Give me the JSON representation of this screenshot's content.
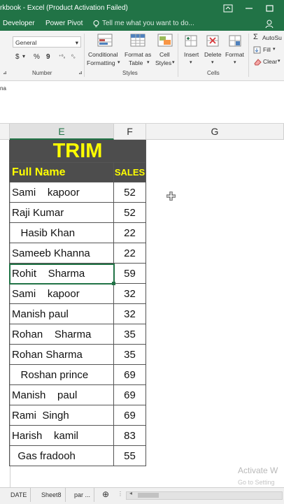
{
  "window": {
    "title": "rkbook - Excel (Product Activation Failed)"
  },
  "ribbon_tabs": {
    "developer": "Developer",
    "power_pivot": "Power Pivot",
    "tell_me": "Tell me what you want to do..."
  },
  "ribbon": {
    "number_format": "General",
    "currency_symbol": "$",
    "percent_symbol": "%",
    "comma_symbol": "9",
    "conditional_formatting": [
      "Conditional",
      "Formatting"
    ],
    "format_as_table": [
      "Format as",
      "Table"
    ],
    "cell_styles": [
      "Cell",
      "Styles"
    ],
    "insert": "Insert",
    "delete": "Delete",
    "format": "Format",
    "autosum": "AutoSu",
    "fill": "Fill",
    "clear": "Clear",
    "groups": {
      "number": "Number",
      "styles": "Styles",
      "cells": "Cells"
    }
  },
  "formula_bar": {
    "name_box_fragment": "na"
  },
  "columns": [
    "E",
    "F",
    "G"
  ],
  "table": {
    "title": "TRIM",
    "header_name": "Full Name",
    "header_sales": "SALES",
    "rows": [
      {
        "name": "Sami    kapoor",
        "sales": "52"
      },
      {
        "name": "Raji Kumar",
        "sales": "52"
      },
      {
        "name": "   Hasib Khan",
        "sales": "22"
      },
      {
        "name": "Sameeb Khanna",
        "sales": "22"
      },
      {
        "name": "Rohit    Sharma",
        "sales": "59"
      },
      {
        "name": "Sami    kapoor",
        "sales": "32"
      },
      {
        "name": "Manish paul",
        "sales": "32"
      },
      {
        "name": "Rohan    Sharma",
        "sales": "35"
      },
      {
        "name": "Rohan Sharma",
        "sales": "35"
      },
      {
        "name": "   Roshan prince",
        "sales": "69"
      },
      {
        "name": "Manish    paul",
        "sales": "69"
      },
      {
        "name": "Rami  Singh",
        "sales": "69"
      },
      {
        "name": "Harish    kamil",
        "sales": "83"
      },
      {
        "name": "  Gas fradooh",
        "sales": "55"
      }
    ]
  },
  "sheet_tabs": [
    "DATE",
    "Sheet8",
    "par ..."
  ],
  "watermark": {
    "line1": "Activate W",
    "line2": "Go to Setting"
  },
  "colors": {
    "excel_green": "#217346",
    "title_cell_bg": "#4d4d4d",
    "title_text": "#ffff00"
  }
}
